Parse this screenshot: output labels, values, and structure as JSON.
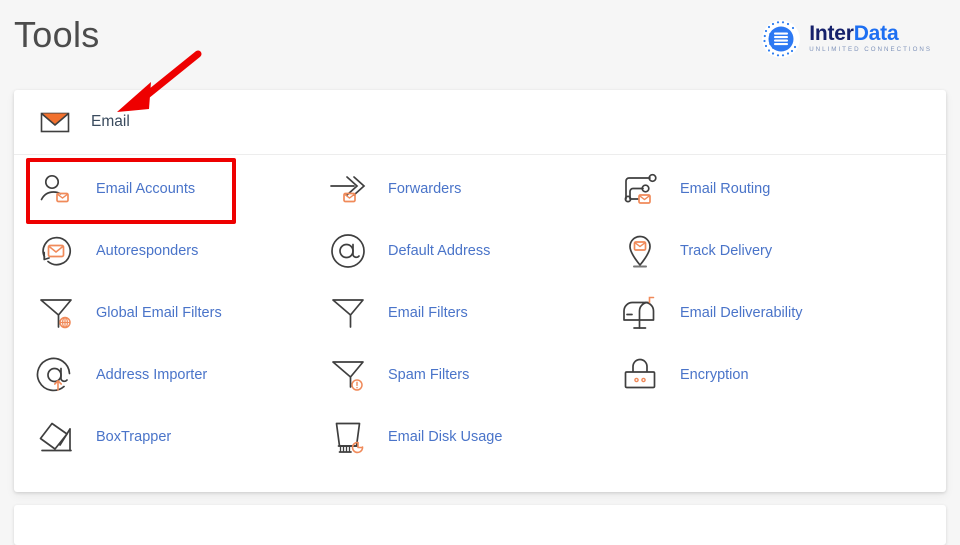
{
  "header": {
    "title": "Tools"
  },
  "brand": {
    "name_part1": "Inter",
    "name_part2": "Data",
    "tagline": "UNLIMITED CONNECTIONS",
    "mark_icon": "interdata-globe-icon",
    "color_dark": "#16216b",
    "color_blue": "#1d6ff2"
  },
  "group": {
    "label": "Email",
    "icon": "envelope-icon"
  },
  "tools": [
    {
      "label": "Email Accounts",
      "icon": "user-envelope-icon"
    },
    {
      "label": "Forwarders",
      "icon": "arrows-forward-envelope-icon"
    },
    {
      "label": "Email Routing",
      "icon": "routing-nodes-envelope-icon"
    },
    {
      "label": "Autoresponders",
      "icon": "envelope-loop-arrow-icon"
    },
    {
      "label": "Default Address",
      "icon": "at-sign-icon"
    },
    {
      "label": "Track Delivery",
      "icon": "map-pin-envelope-icon"
    },
    {
      "label": "Global Email Filters",
      "icon": "funnel-globe-icon"
    },
    {
      "label": "Email Filters",
      "icon": "funnel-icon"
    },
    {
      "label": "Email Deliverability",
      "icon": "mailbox-icon"
    },
    {
      "label": "Address Importer",
      "icon": "at-sign-upload-icon"
    },
    {
      "label": "Spam Filters",
      "icon": "funnel-alert-icon"
    },
    {
      "label": "Encryption",
      "icon": "padlock-icon"
    },
    {
      "label": "BoxTrapper",
      "icon": "box-trap-icon"
    },
    {
      "label": "Email Disk Usage",
      "icon": "bin-pie-chart-icon"
    }
  ],
  "annotations": {
    "highlight_target": "Email Accounts",
    "highlight_color": "#ee0000",
    "arrow_color": "#ee0000"
  },
  "theme": {
    "page_background": "#f6f6f6",
    "card_background": "#ffffff",
    "link_color": "#4a74c9",
    "icon_accent": "#f08a5a",
    "icon_stroke": "#3f3f3f",
    "title_color": "#4c4c4c"
  }
}
